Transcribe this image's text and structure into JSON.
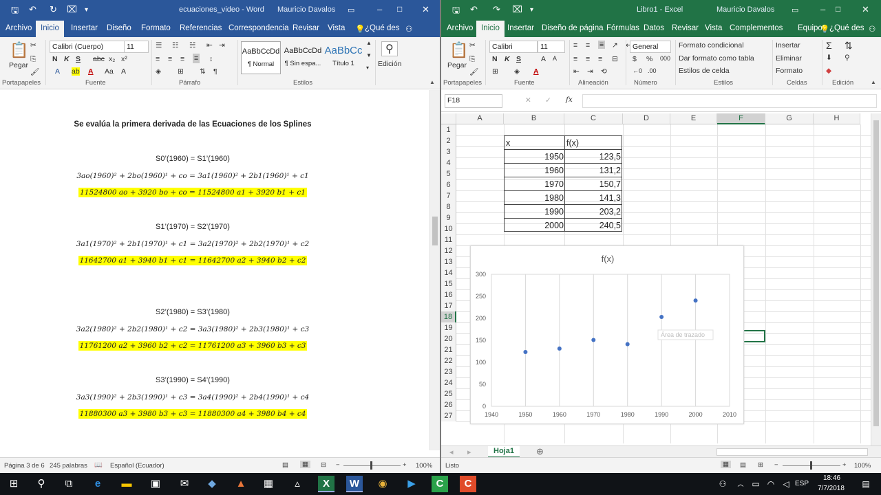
{
  "word": {
    "title": "ecuaciones_video  -  Word",
    "user": "Mauricio Davalos",
    "tabs": [
      "Archivo",
      "Inicio",
      "Insertar",
      "Diseño",
      "Formato",
      "Referencias",
      "Correspondencia",
      "Revisar",
      "Vista",
      "¿Qué des"
    ],
    "ribbon": {
      "paste": "Pegar",
      "font": "Calibri (Cuerpo)",
      "size": "11",
      "styles": [
        {
          "sample": "AaBbCcDd",
          "name": "¶ Normal"
        },
        {
          "sample": "AaBbCcDd",
          "name": "¶ Sin espa..."
        },
        {
          "sample": "AaBbCc",
          "name": "Título 1"
        }
      ],
      "edit": "Edición",
      "groups": [
        "Portapapeles",
        "Fuente",
        "Párrafo",
        "Estilos"
      ]
    },
    "doc": {
      "heading": "Se evalúa la primera derivada de las Ecuaciones de los Splines",
      "blocks": [
        {
          "title": "S0’(1960) = S1’(1960)",
          "eq": "3ao(1960)² + 2bo(1960)¹ + co =  3a1(1960)² + 2b1(1960)¹ + c1",
          "hl": "11524800 ao +  3920 bo + co =  11524800 a1 +  3920 b1 + c1"
        },
        {
          "title": "S1’(1970) = S2’(1970)",
          "eq": "3a1(1970)² + 2b1(1970)¹ + c1 =  3a2(1970)² + 2b2(1970)¹ + c2",
          "hl": "11642700 a1 +  3940 b1 + c1 =  11642700 a2 +  3940 b2 + c2"
        },
        {
          "title": "S2’(1980) = S3’(1980)",
          "eq": "3a2(1980)² + 2b2(1980)¹ + c2 =  3a3(1980)² + 2b3(1980)¹ + c3",
          "hl": "11761200 a2 +  3960 b2 + c2 =  11761200 a3 +  3960 b3 + c3"
        },
        {
          "title": "S3’(1990) = S4’(1990)",
          "eq": "3a3(1990)² + 2b3(1990)¹ + c3 =  3a4(1990)² + 2b4(1990)¹ + c4",
          "hl": "11880300 a3 +  3980 b3 + c3 =  11880300 a4 +  3980 b4 + c4"
        }
      ]
    },
    "status": {
      "page": "Página 3 de 6",
      "words": "245 palabras",
      "lang": "Español (Ecuador)",
      "zoom": "100%"
    }
  },
  "excel": {
    "title": "Libro1  -  Excel",
    "user": "Mauricio Davalos",
    "tabs": [
      "Archivo",
      "Inicio",
      "Insertar",
      "Diseño de página",
      "Fórmulas",
      "Datos",
      "Revisar",
      "Vista",
      "Complementos",
      "Equipo",
      "¿Qué des"
    ],
    "ribbon": {
      "paste": "Pegar",
      "font": "Calibri",
      "size": "11",
      "numfmt": "General",
      "cond": "Formato condicional",
      "table": "Dar formato como tabla",
      "cellstyles": "Estilos de celda",
      "insert": "Insertar",
      "delete": "Eliminar",
      "format": "Formato",
      "edit_sum": "Σ",
      "groups": [
        "Portapapeles",
        "Fuente",
        "Alineación",
        "Número",
        "Estilos",
        "Celdas",
        "Edición"
      ]
    },
    "namebox": "F18",
    "fx": "fx",
    "columns": [
      "A",
      "B",
      "C",
      "D",
      "E",
      "F",
      "G",
      "H"
    ],
    "rows": [
      "1",
      "2",
      "3",
      "4",
      "5",
      "6",
      "7",
      "8",
      "9",
      "10",
      "11",
      "12",
      "13",
      "14",
      "15",
      "16",
      "17",
      "18",
      "19",
      "20",
      "21",
      "22",
      "23",
      "24",
      "25",
      "26",
      "27"
    ],
    "table": {
      "headers": [
        "x",
        "f(x)"
      ],
      "rows": [
        [
          "1950",
          "123,5"
        ],
        [
          "1960",
          "131,2"
        ],
        [
          "1970",
          "150,7"
        ],
        [
          "1980",
          "141,3"
        ],
        [
          "1990",
          "203,2"
        ],
        [
          "2000",
          "240,5"
        ]
      ]
    },
    "sheet": "Hoja1",
    "status": {
      "ready": "Listo",
      "zoom": "100%"
    }
  },
  "chart_data": {
    "type": "scatter",
    "title": "f(x)",
    "x": [
      1950,
      1960,
      1970,
      1980,
      1990,
      2000
    ],
    "y": [
      123.5,
      131.2,
      150.7,
      141.3,
      203.2,
      240.5
    ],
    "xlim": [
      1940,
      2010
    ],
    "ylim": [
      0,
      300
    ],
    "xticks": [
      "1940",
      "1950",
      "1960",
      "1970",
      "1980",
      "1990",
      "2000",
      "2010"
    ],
    "yticks": [
      "0",
      "50",
      "100",
      "150",
      "200",
      "250",
      "300"
    ],
    "tooltip": "Área de trazado",
    "grid": "vertical",
    "color": "#4472c4"
  },
  "taskbar": {
    "time": "18:46",
    "date": "7/7/2018",
    "lang": "ESP"
  }
}
